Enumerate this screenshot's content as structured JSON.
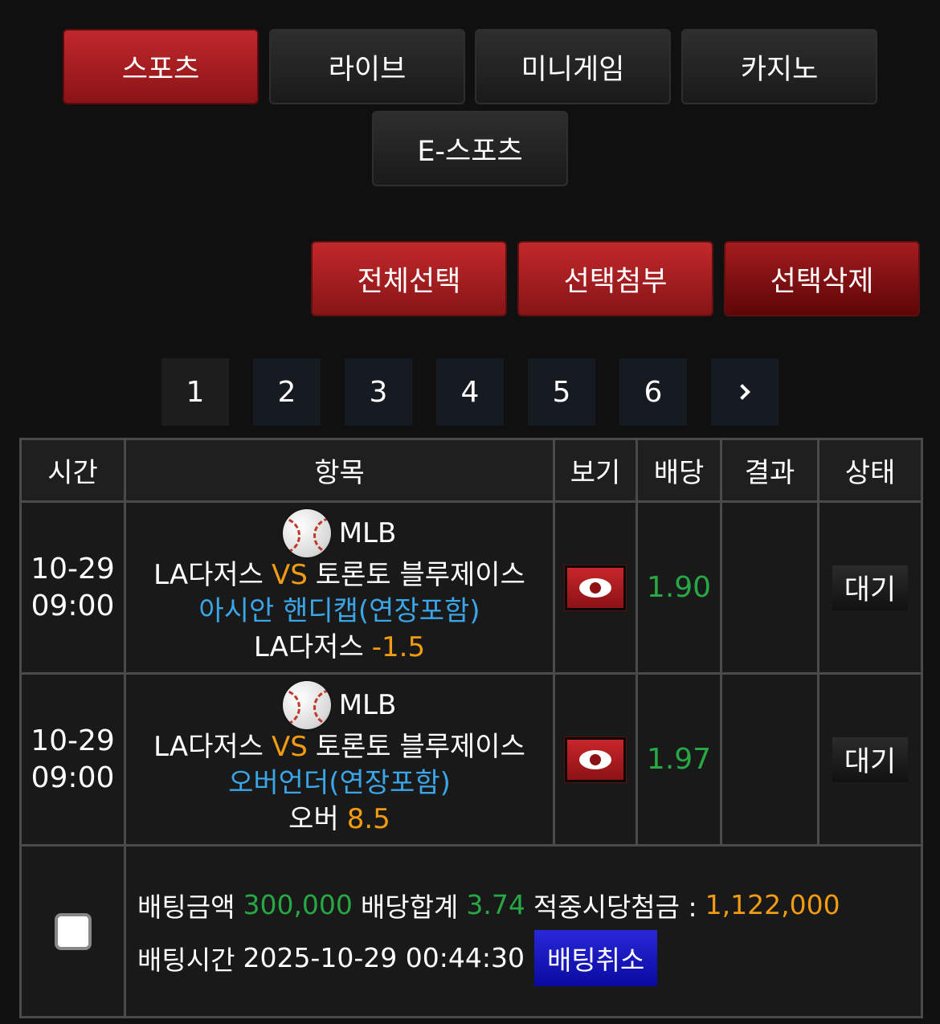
{
  "categories": [
    {
      "label": "스포츠",
      "active": true
    },
    {
      "label": "라이브",
      "active": false
    },
    {
      "label": "미니게임",
      "active": false
    },
    {
      "label": "카지노",
      "active": false
    },
    {
      "label": "E-스포츠",
      "active": false
    }
  ],
  "actions": {
    "select_all": "전체선택",
    "attach_selected": "선택첨부",
    "delete_selected": "선택삭제"
  },
  "pagination": {
    "pages": [
      "1",
      "2",
      "3",
      "4",
      "5",
      "6"
    ],
    "current": "1",
    "next_icon": "chevron-right-icon"
  },
  "table": {
    "headers": [
      "시간",
      "항목",
      "보기",
      "배당",
      "결과",
      "상태"
    ],
    "rows": [
      {
        "date": "10-29",
        "time": "09:00",
        "league": "MLB",
        "sport_icon": "baseball-icon",
        "home": "LA다저스",
        "vs": "VS",
        "away": "토론토 블루제이스",
        "market": "아시안 핸디캡(연장포함)",
        "pick": "LA다저스",
        "pick_value": "-1.5",
        "odds": "1.90",
        "result": "",
        "status": "대기"
      },
      {
        "date": "10-29",
        "time": "09:00",
        "league": "MLB",
        "sport_icon": "baseball-icon",
        "home": "LA다저스",
        "vs": "VS",
        "away": "토론토 블루제이스",
        "market": "오버언더(연장포함)",
        "pick": "오버",
        "pick_value": "8.5",
        "odds": "1.97",
        "result": "",
        "status": "대기"
      }
    ]
  },
  "summary": {
    "bet_amount_label": "배팅금액",
    "bet_amount": "300,000",
    "odds_total_label": "배당합계",
    "odds_total": "3.74",
    "payout_label": "적중시당첨금 :",
    "payout": "1,122,000",
    "bet_time_label": "배팅시간",
    "bet_time": "2025-10-29 00:44:30",
    "cancel_label": "배팅취소"
  },
  "colors": {
    "accent_red": "#c0282c",
    "odds_green": "#27a844",
    "highlight_orange": "#f39c12",
    "market_blue": "#3aa6e8",
    "cancel_blue": "#2828d8"
  }
}
